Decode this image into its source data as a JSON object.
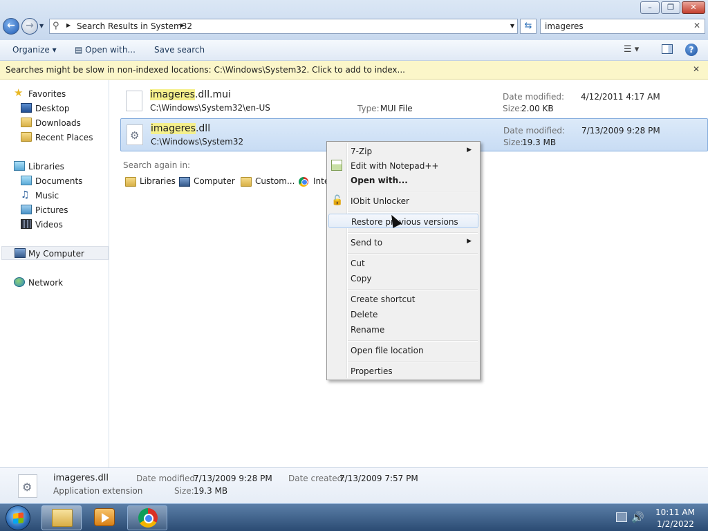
{
  "window": {
    "minimize_glyph": "–",
    "maximize_glyph": "❐",
    "close_glyph": "✕"
  },
  "address": {
    "breadcrumb": "Search Results in System32",
    "arrow_glyph": "▶",
    "dropdown_glyph": "▼"
  },
  "nav_glyphs": {
    "back": "←",
    "forward": "→",
    "recent": "▼",
    "refresh": "⇆"
  },
  "search": {
    "value": "imageres",
    "clear_glyph": "✕"
  },
  "toolbar": {
    "organize": "Organize ▾",
    "open_with": "Open with...",
    "save_search": "Save search",
    "views_glyph": "☰ ▾",
    "help_glyph": "?"
  },
  "infobar": {
    "message": "Searches might be slow in non-indexed locations: C:\\Windows\\System32. Click to add to index...",
    "close_glyph": "✕"
  },
  "sidebar": {
    "favorites": {
      "label": "Favorites",
      "items": [
        "Desktop",
        "Downloads",
        "Recent Places"
      ]
    },
    "libraries": {
      "label": "Libraries",
      "items": [
        "Documents",
        "Music",
        "Pictures",
        "Videos"
      ]
    },
    "computer": "My Computer",
    "network": "Network",
    "star_glyph": "★",
    "music_glyph": "♫"
  },
  "results": [
    {
      "name_match": "imageres",
      "name_rest": ".dll.mui",
      "path": "C:\\Windows\\System32\\en-US",
      "type_label": "Type:",
      "type_value": "MUI File",
      "date_label": "Date modified:",
      "date_value": "4/12/2011 4:17 AM",
      "size_label": "Size:",
      "size_value": "2.00 KB"
    },
    {
      "name_match": "imageres",
      "name_rest": ".dll",
      "path": "C:\\Windows\\System32",
      "date_label": "Date modified:",
      "date_value": "7/13/2009 9:28 PM",
      "size_label": "Size:",
      "size_value": "19.3 MB"
    }
  ],
  "search_again": {
    "label": "Search again in:",
    "options": [
      "Libraries",
      "Computer",
      "Custom...",
      "Inte"
    ]
  },
  "context_menu": {
    "submenu_glyph": "▶",
    "lock_glyph": "🔓",
    "items": [
      "7-Zip",
      "Edit with Notepad++",
      "Open with...",
      "IObit Unlocker",
      "Restore previous versions",
      "Send to",
      "Cut",
      "Copy",
      "Create shortcut",
      "Delete",
      "Rename",
      "Open file location",
      "Properties"
    ]
  },
  "details": {
    "name": "imageres.dll",
    "type": "Application extension",
    "date_modified_label": "Date modified:",
    "date_modified": "7/13/2009 9:28 PM",
    "size_label": "Size:",
    "size": "19.3 MB",
    "date_created_label": "Date created:",
    "date_created": "7/13/2009 7:57 PM"
  },
  "taskbar": {
    "time": "10:11 AM",
    "date": "1/2/2022",
    "volume_glyph": "🔊"
  }
}
